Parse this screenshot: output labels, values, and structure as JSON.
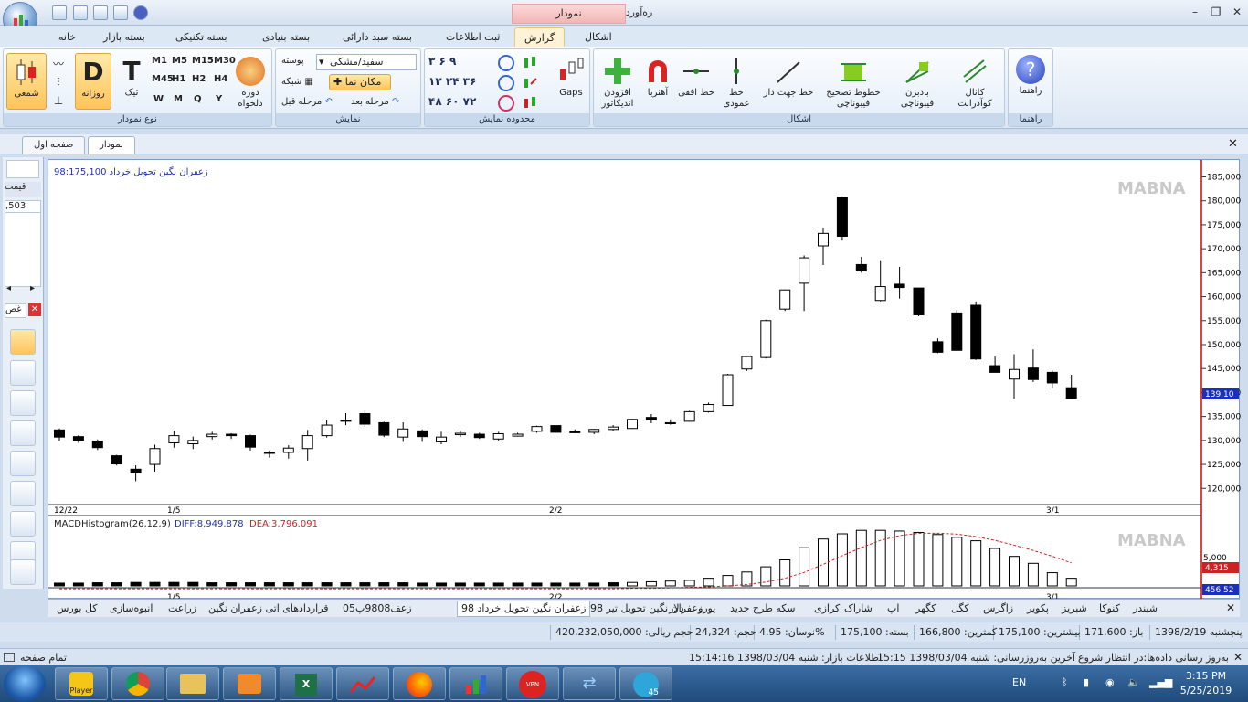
{
  "window": {
    "title": "ره‌آورد نوین ۳",
    "context_tab": "نمودار"
  },
  "ribbon_tabs": [
    "اشکال",
    "گزارش",
    "ثبت اطلاعات",
    "بسته سبد دارائی",
    "بسته بنیادی",
    "بسته تکنیکی",
    "بسته بازار",
    "خانه"
  ],
  "groups": {
    "help": {
      "label": "راهنما",
      "button": "راهنما"
    },
    "shapes": {
      "label": "اشکال",
      "buttons": [
        "کانال کوآدرانت",
        "بادبزن فیبوناچی",
        "خطوط تصحیح فیبوناچی",
        "خط جهت دار",
        "خط عمودی",
        "خط افقی",
        "آهنربا",
        "افزودن اندیکاتور"
      ]
    },
    "gaps": "Gaps",
    "range": {
      "label": "محدوده نمایش"
    },
    "display": {
      "label": "نمایش",
      "theme": "سفید/مشکی",
      "shell": "پوسته",
      "cursor": "مکان نما",
      "grid": "شبکه",
      "next": "مرحله بعد",
      "prev": "مرحله قبل"
    },
    "chart_type": {
      "label": "نوع نمودار",
      "custom": "دوره دلخواه",
      "daily": "روزانه",
      "tick": "تیک",
      "solar": "شمعی",
      "daily_letter": "D",
      "tick_letter": "T",
      "periods": [
        "M1",
        "M5",
        "M15",
        "M30",
        "M45",
        "H1",
        "H2",
        "H4",
        "W",
        "M",
        "Q",
        "Y"
      ]
    }
  },
  "doc_tabs": [
    "نمودار",
    "صفحه اول"
  ],
  "left_panel": {
    "col": "قیمت",
    "value": ",503",
    "search": "غص"
  },
  "chart": {
    "title": "زعفران نگین تحویل خرداد  98:175,100",
    "watermark": "MABNA",
    "macd_label": "MACDHistogram(26,12,9)",
    "diff": "DIFF:8,949.878",
    "dea": "DEA:3,796.091",
    "last_price": "139,10",
    "macd_vals": [
      "4,315",
      "456.52"
    ],
    "macd_axis": "5,000",
    "x_labels": [
      "12/22",
      "1/5",
      "2/2",
      "3/1"
    ],
    "y_labels": [
      "185,000",
      "180,000",
      "175,000",
      "170,000",
      "165,000",
      "160,000",
      "155,000",
      "150,000",
      "145,000",
      "140,000",
      "135,000",
      "130,000",
      "125,000",
      "120,000"
    ]
  },
  "chart_data": {
    "type": "candlestick",
    "ylim": [
      117000,
      187000
    ],
    "candles": [
      [
        132200,
        132500,
        129800,
        130700
      ],
      [
        130800,
        131100,
        129500,
        130000
      ],
      [
        129800,
        130200,
        128000,
        128500
      ],
      [
        126800,
        127000,
        124800,
        125100
      ],
      [
        124000,
        124800,
        121500,
        123200
      ],
      [
        125000,
        129100,
        123500,
        128300
      ],
      [
        129500,
        132000,
        128500,
        131000
      ],
      [
        129300,
        130800,
        128200,
        130000
      ],
      [
        130800,
        131800,
        130200,
        131300
      ],
      [
        131300,
        131500,
        130300,
        131000
      ],
      [
        131000,
        131200,
        127900,
        128600
      ],
      [
        127500,
        127900,
        126400,
        127300
      ],
      [
        127500,
        129000,
        126200,
        128400
      ],
      [
        128300,
        132200,
        125800,
        131000
      ],
      [
        131000,
        134200,
        130600,
        133200
      ],
      [
        134200,
        135700,
        133200,
        134000
      ],
      [
        135600,
        136400,
        132800,
        133400
      ],
      [
        133700,
        133900,
        130700,
        131100
      ],
      [
        130700,
        133800,
        129700,
        132400
      ],
      [
        132000,
        132300,
        129700,
        130800
      ],
      [
        129700,
        131800,
        129200,
        130700
      ],
      [
        131200,
        132000,
        130700,
        131500
      ],
      [
        131300,
        131600,
        130300,
        130600
      ],
      [
        130300,
        131800,
        130000,
        131400
      ],
      [
        130900,
        131600,
        130800,
        131300
      ],
      [
        131900,
        133100,
        131600,
        132900
      ],
      [
        133100,
        133100,
        131600,
        131700
      ],
      [
        131800,
        132300,
        131500,
        131800
      ],
      [
        131700,
        132400,
        131300,
        132300
      ],
      [
        132300,
        133200,
        132000,
        132800
      ],
      [
        132500,
        134500,
        132400,
        134400
      ],
      [
        134800,
        135500,
        133600,
        134300
      ],
      [
        133500,
        134400,
        133300,
        133700
      ],
      [
        134000,
        136200,
        133900,
        136000
      ],
      [
        136000,
        137900,
        135800,
        137500
      ],
      [
        137300,
        143900,
        137300,
        143700
      ],
      [
        144900,
        147700,
        144500,
        147500
      ],
      [
        147300,
        155200,
        147100,
        155000
      ],
      [
        157400,
        161500,
        157000,
        161400
      ],
      [
        162800,
        168600,
        157000,
        168100
      ],
      [
        170600,
        174400,
        166600,
        173200
      ],
      [
        180700,
        180900,
        171700,
        172600
      ],
      [
        166700,
        168300,
        165000,
        165400
      ],
      [
        159200,
        167600,
        159000,
        162100
      ],
      [
        162600,
        166200,
        159600,
        161900
      ],
      [
        161800,
        161800,
        155900,
        156200
      ],
      [
        150600,
        151300,
        148200,
        148400
      ],
      [
        156600,
        157200,
        148700,
        148800
      ],
      [
        158200,
        159000,
        146800,
        147000
      ],
      [
        145600,
        147500,
        144200,
        144200
      ],
      [
        142800,
        148000,
        138700,
        144800
      ],
      [
        145100,
        149000,
        142200,
        142700
      ],
      [
        144200,
        144600,
        140900,
        142000
      ],
      [
        141000,
        143700,
        138700,
        138800
      ]
    ],
    "macd": [
      8,
      8,
      9,
      9,
      10,
      10,
      10,
      10,
      9,
      9,
      9,
      9,
      9,
      9,
      9,
      9,
      9,
      9,
      9,
      8,
      8,
      8,
      8,
      8,
      8,
      8,
      8,
      8,
      8,
      9,
      10,
      12,
      14,
      16,
      22,
      30,
      40,
      55,
      75,
      110,
      135,
      150,
      160,
      160,
      158,
      154,
      148,
      140,
      130,
      108,
      85,
      65,
      38,
      22
    ],
    "dea_curve": [
      -6,
      -6,
      -6,
      -6,
      -6,
      -6,
      -6,
      -6,
      -6,
      -6,
      -6,
      -6,
      -6,
      -6,
      -6,
      -6,
      -6,
      -6,
      -6,
      -6,
      -6,
      -6,
      -6,
      -6,
      -6,
      -6,
      -6,
      -6,
      -6,
      -6,
      -5,
      -5,
      -4,
      -3,
      -2,
      0,
      3,
      8,
      16,
      28,
      45,
      63,
      80,
      95,
      105,
      110,
      110,
      108,
      103,
      95,
      85,
      74,
      62,
      48
    ]
  },
  "symbols": [
    "شبندر",
    "کنوکا",
    "شبریز",
    "پکویر",
    "زاگرس",
    "کگل",
    "کگهر",
    "اپ",
    "شاراک",
    "کرازی",
    "سکه طرح جدید",
    "یورو",
    "دلار",
    "زعفران نگین تحویل تیر 98",
    "زعفران نگین تحویل خرداد 98",
    "زعف9808پ05",
    "قراردادهای اتی زعفران نگین",
    "زراعت",
    "انبوه‌سازی",
    "کل بورس"
  ],
  "info": [
    "پنجشنبه 1398/2/19",
    "باز: 171,600",
    "بیشترین: 175,100",
    "کمترین: 166,800",
    "بسته: 175,100",
    "نوسان: 4.95%",
    "حجم: 24,324",
    "حجم ریالی: 420,232,050,000"
  ],
  "status": {
    "left": "تمام صفحه",
    "update": "به‌روز رسانی داده‌ها:در انتظار شروع",
    "last": "آخرین به‌روزرسانی: شنبه 1398/03/04 15:15",
    "market": "اطلاعات بازار: شنبه 1398/03/04 15:14:16"
  },
  "taskbar": {
    "lang": "EN",
    "time": "3:15 PM",
    "date": "5/25/2019",
    "player": "Player",
    "vpn": "VPN Like",
    "badge": "45"
  }
}
